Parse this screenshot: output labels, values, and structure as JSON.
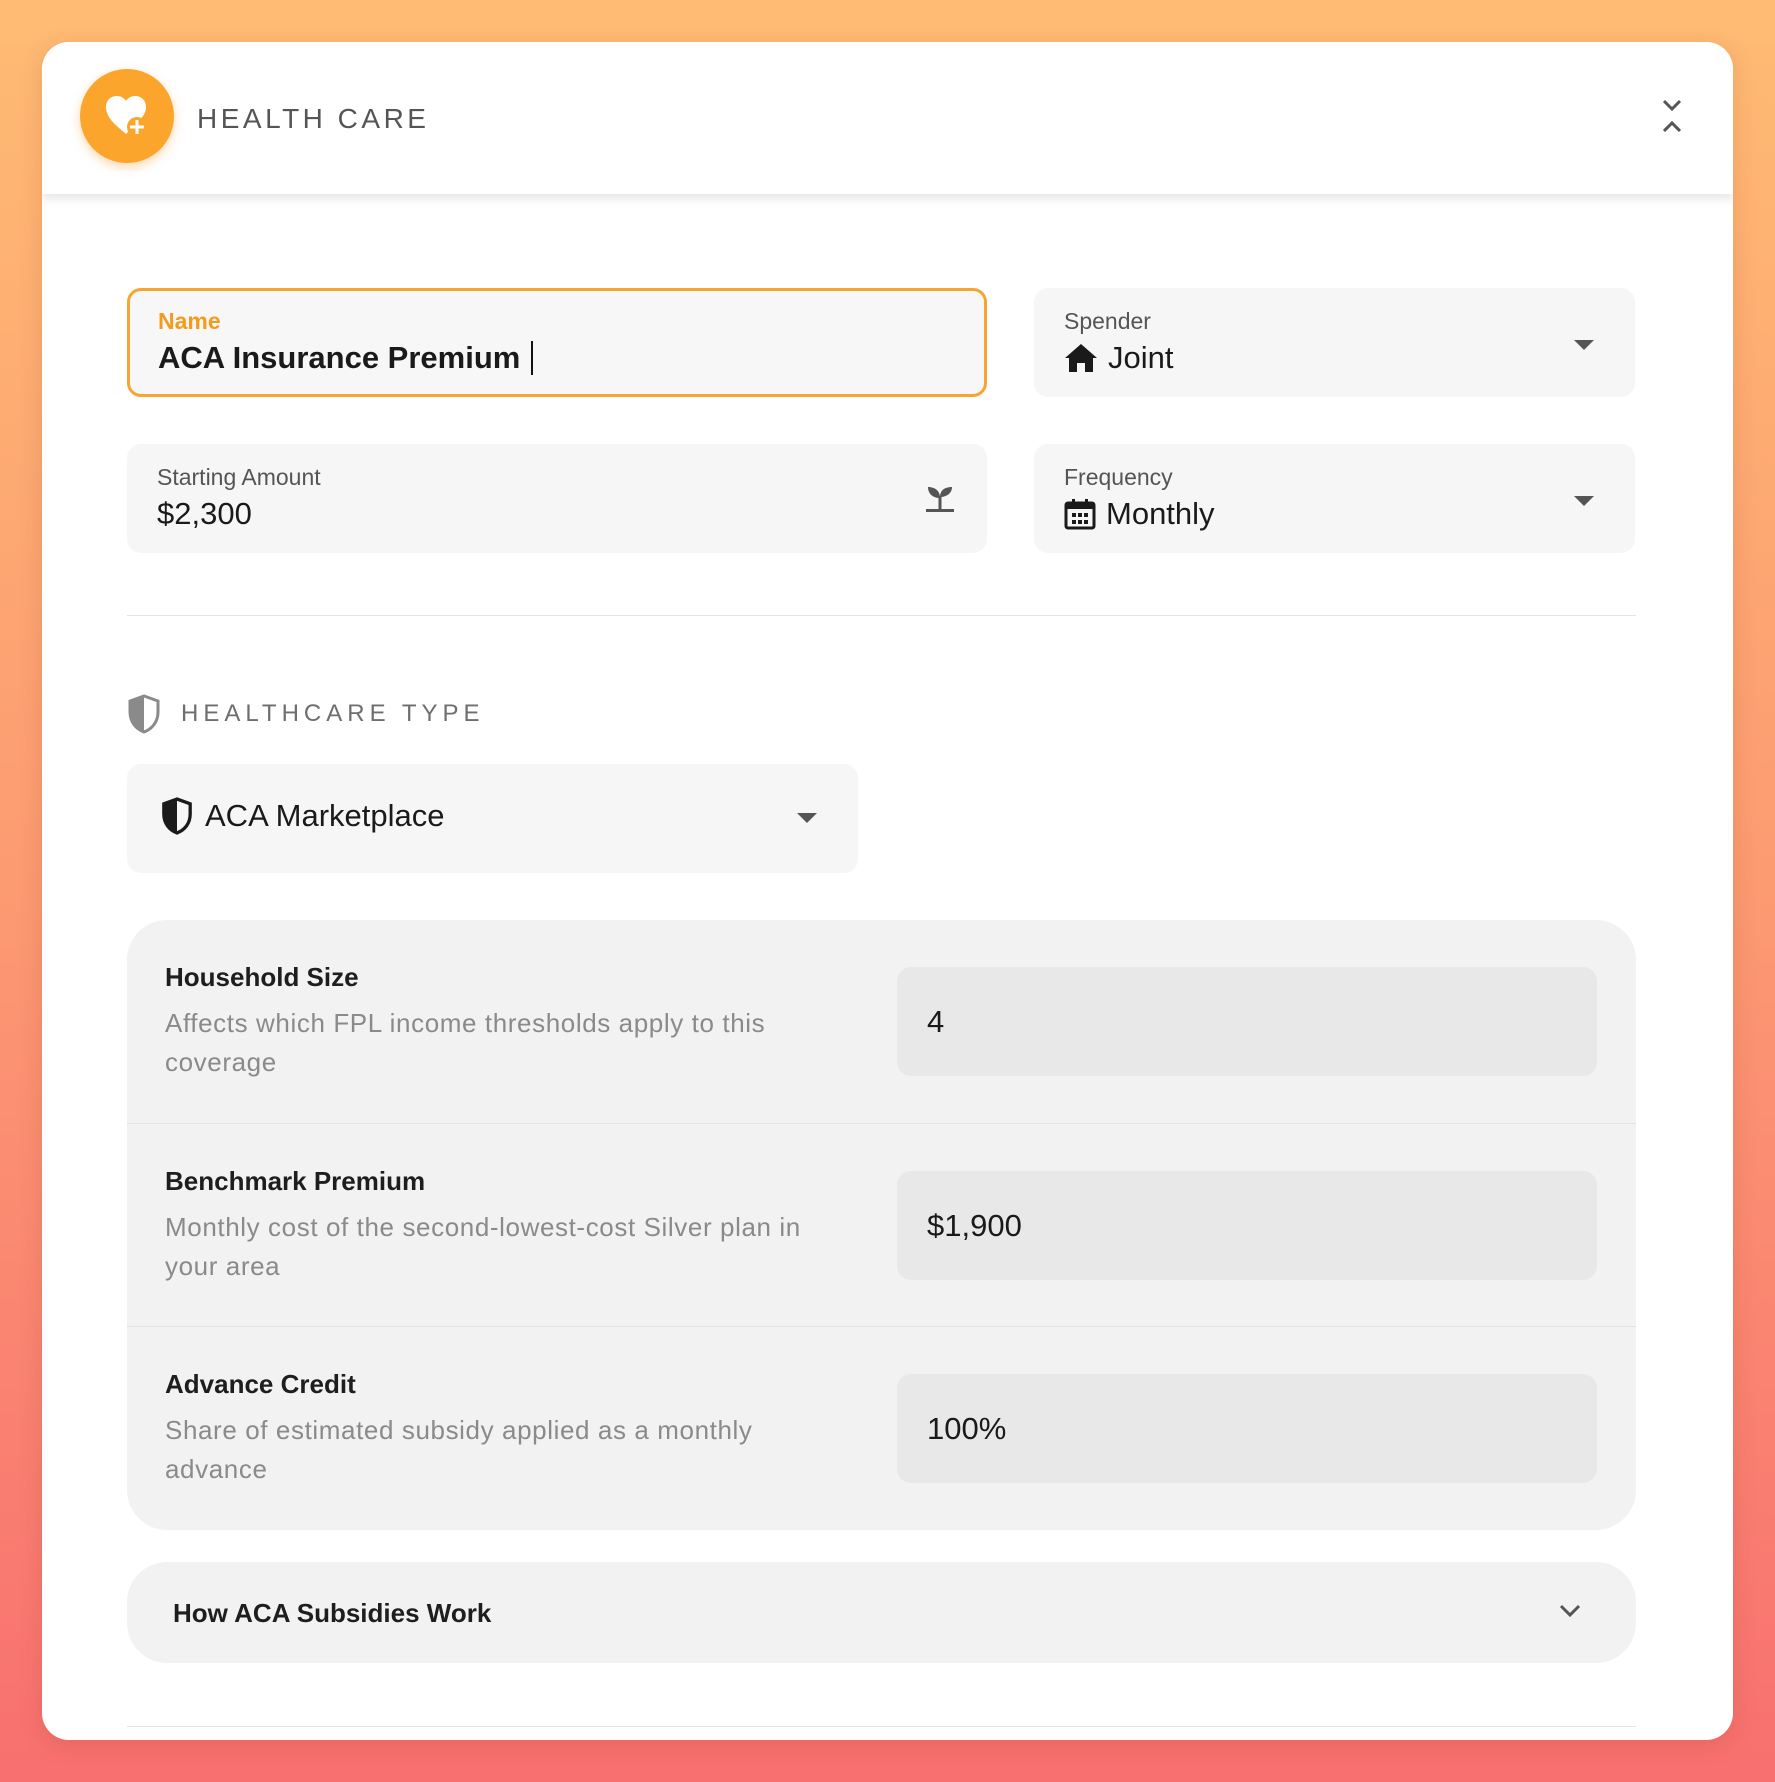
{
  "header": {
    "title": "HEALTH CARE",
    "icon": "heart-plus-icon",
    "collapse_icon": "collapse-icon"
  },
  "form": {
    "name": {
      "label": "Name",
      "value": "ACA Insurance Premium"
    },
    "spender": {
      "label": "Spender",
      "value": "Joint",
      "icon": "home-icon"
    },
    "starting_amount": {
      "label": "Starting Amount",
      "value": "$2,300",
      "icon": "sprout-icon"
    },
    "frequency": {
      "label": "Frequency",
      "value": "Monthly",
      "icon": "calendar-icon"
    }
  },
  "healthcare_type": {
    "section_title": "HEALTHCARE TYPE",
    "selected": "ACA Marketplace",
    "icon": "shield-icon"
  },
  "params": [
    {
      "label": "Household Size",
      "description": "Affects which FPL income thresholds apply to this coverage",
      "value": "4"
    },
    {
      "label": "Benchmark Premium",
      "description": "Monthly cost of the second-lowest-cost Silver plan in your area",
      "value": "$1,900"
    },
    {
      "label": "Advance Credit",
      "description": "Share of estimated subsidy applied as a monthly advance",
      "value": "100%"
    }
  ],
  "accordion": {
    "label": "How ACA Subsidies Work"
  },
  "colors": {
    "accent": "#fca52c",
    "focus_border": "#f7a531",
    "focus_label": "#f49a1c"
  }
}
